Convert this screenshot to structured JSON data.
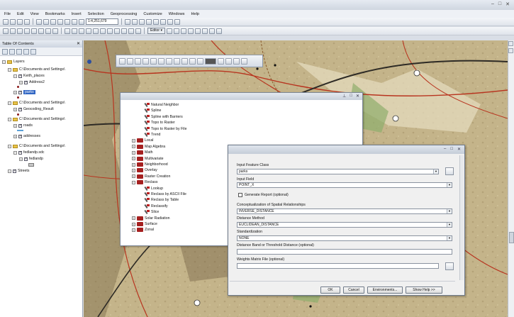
{
  "menu": [
    "File",
    "Edit",
    "View",
    "Bookmarks",
    "Insert",
    "Selection",
    "Geoprocessing",
    "Customize",
    "Windows",
    "Help"
  ],
  "toolbar": {
    "scale": "1:4,251,679",
    "editor": "Editor ▾"
  },
  "toc": {
    "title": "Table Of Contents",
    "close": "✕",
    "items": [
      {
        "label": "Layers",
        "indent": 0,
        "kind": "root"
      },
      {
        "label": "C:\\Documents and Settings\\",
        "indent": 1,
        "kind": "folder"
      },
      {
        "label": "Keith_places",
        "indent": 2,
        "kind": "group"
      },
      {
        "label": "Address2",
        "indent": 3,
        "kind": "layer"
      },
      {
        "label": "parks",
        "indent": 2,
        "kind": "layer"
      },
      {
        "label": "C:\\Documents and Settings\\",
        "indent": 1,
        "kind": "folder"
      },
      {
        "label": "Geocoding_Result",
        "indent": 2,
        "kind": "layer"
      },
      {
        "label": "C:\\Documents and Settings\\",
        "indent": 1,
        "kind": "folder"
      },
      {
        "label": "roads",
        "indent": 2,
        "kind": "layer"
      },
      {
        "label": "addresses",
        "indent": 2,
        "kind": "layer"
      },
      {
        "label": "C:\\Documents and Settings\\",
        "indent": 1,
        "kind": "folder"
      },
      {
        "label": "fedlandp.sdc",
        "indent": 2,
        "kind": "group"
      },
      {
        "label": "fedlandp",
        "indent": 3,
        "kind": "layer"
      },
      {
        "label": "Streets",
        "indent": 1,
        "kind": "layer"
      }
    ]
  },
  "toolbox": {
    "items": [
      {
        "label": "Natural Neighbor",
        "type": "tool",
        "indent": 2
      },
      {
        "label": "Spline",
        "type": "tool",
        "indent": 2
      },
      {
        "label": "Spline with Barriers",
        "type": "tool",
        "indent": 2
      },
      {
        "label": "Topo to Raster",
        "type": "tool",
        "indent": 2
      },
      {
        "label": "Topo to Raster by File",
        "type": "tool",
        "indent": 2
      },
      {
        "label": "Trend",
        "type": "tool",
        "indent": 2
      },
      {
        "label": "Local",
        "type": "box",
        "indent": 1
      },
      {
        "label": "Map Algebra",
        "type": "box",
        "indent": 1
      },
      {
        "label": "Math",
        "type": "box",
        "indent": 1
      },
      {
        "label": "Multivariate",
        "type": "box",
        "indent": 1
      },
      {
        "label": "Neighborhood",
        "type": "box",
        "indent": 1
      },
      {
        "label": "Overlay",
        "type": "box",
        "indent": 1
      },
      {
        "label": "Raster Creation",
        "type": "box",
        "indent": 1
      },
      {
        "label": "Reclass",
        "type": "boxopen",
        "indent": 1
      },
      {
        "label": "Lookup",
        "type": "tool",
        "indent": 2
      },
      {
        "label": "Reclass by ASCII File",
        "type": "tool",
        "indent": 2
      },
      {
        "label": "Reclass by Table",
        "type": "tool",
        "indent": 2
      },
      {
        "label": "Reclassify",
        "type": "tool",
        "indent": 2
      },
      {
        "label": "Slice",
        "type": "tool",
        "indent": 2
      },
      {
        "label": "Solar Radiation",
        "type": "box",
        "indent": 1
      },
      {
        "label": "Surface",
        "type": "box",
        "indent": 1
      },
      {
        "label": "Zonal",
        "type": "box",
        "indent": 1
      }
    ]
  },
  "dialog": {
    "input_feature_class_label": "Input Feature Class",
    "input_feature_class_value": "parks",
    "input_field_label": "Input Field",
    "input_field_value": "POINT_X",
    "generate_report_label": "Generate Report (optional)",
    "conceptualization_label": "Conceptualization of Spatial Relationships",
    "conceptualization_value": "INVERSE_DISTANCE",
    "distance_method_label": "Distance Method",
    "distance_method_value": "EUCLIDEAN_DISTANCE",
    "standardization_label": "Standardization",
    "standardization_value": "NONE",
    "distance_band_label": "Distance Band or Threshold Distance (optional)",
    "weights_matrix_label": "Weights Matrix File (optional)",
    "ok": "OK",
    "cancel": "Cancel",
    "environments": "Environments...",
    "show_help": "Show Help >>"
  },
  "colors": {
    "map_base": "#c2b286",
    "road": "#b8341f",
    "highway": "#2d2a25",
    "park": "#7fa35f"
  }
}
